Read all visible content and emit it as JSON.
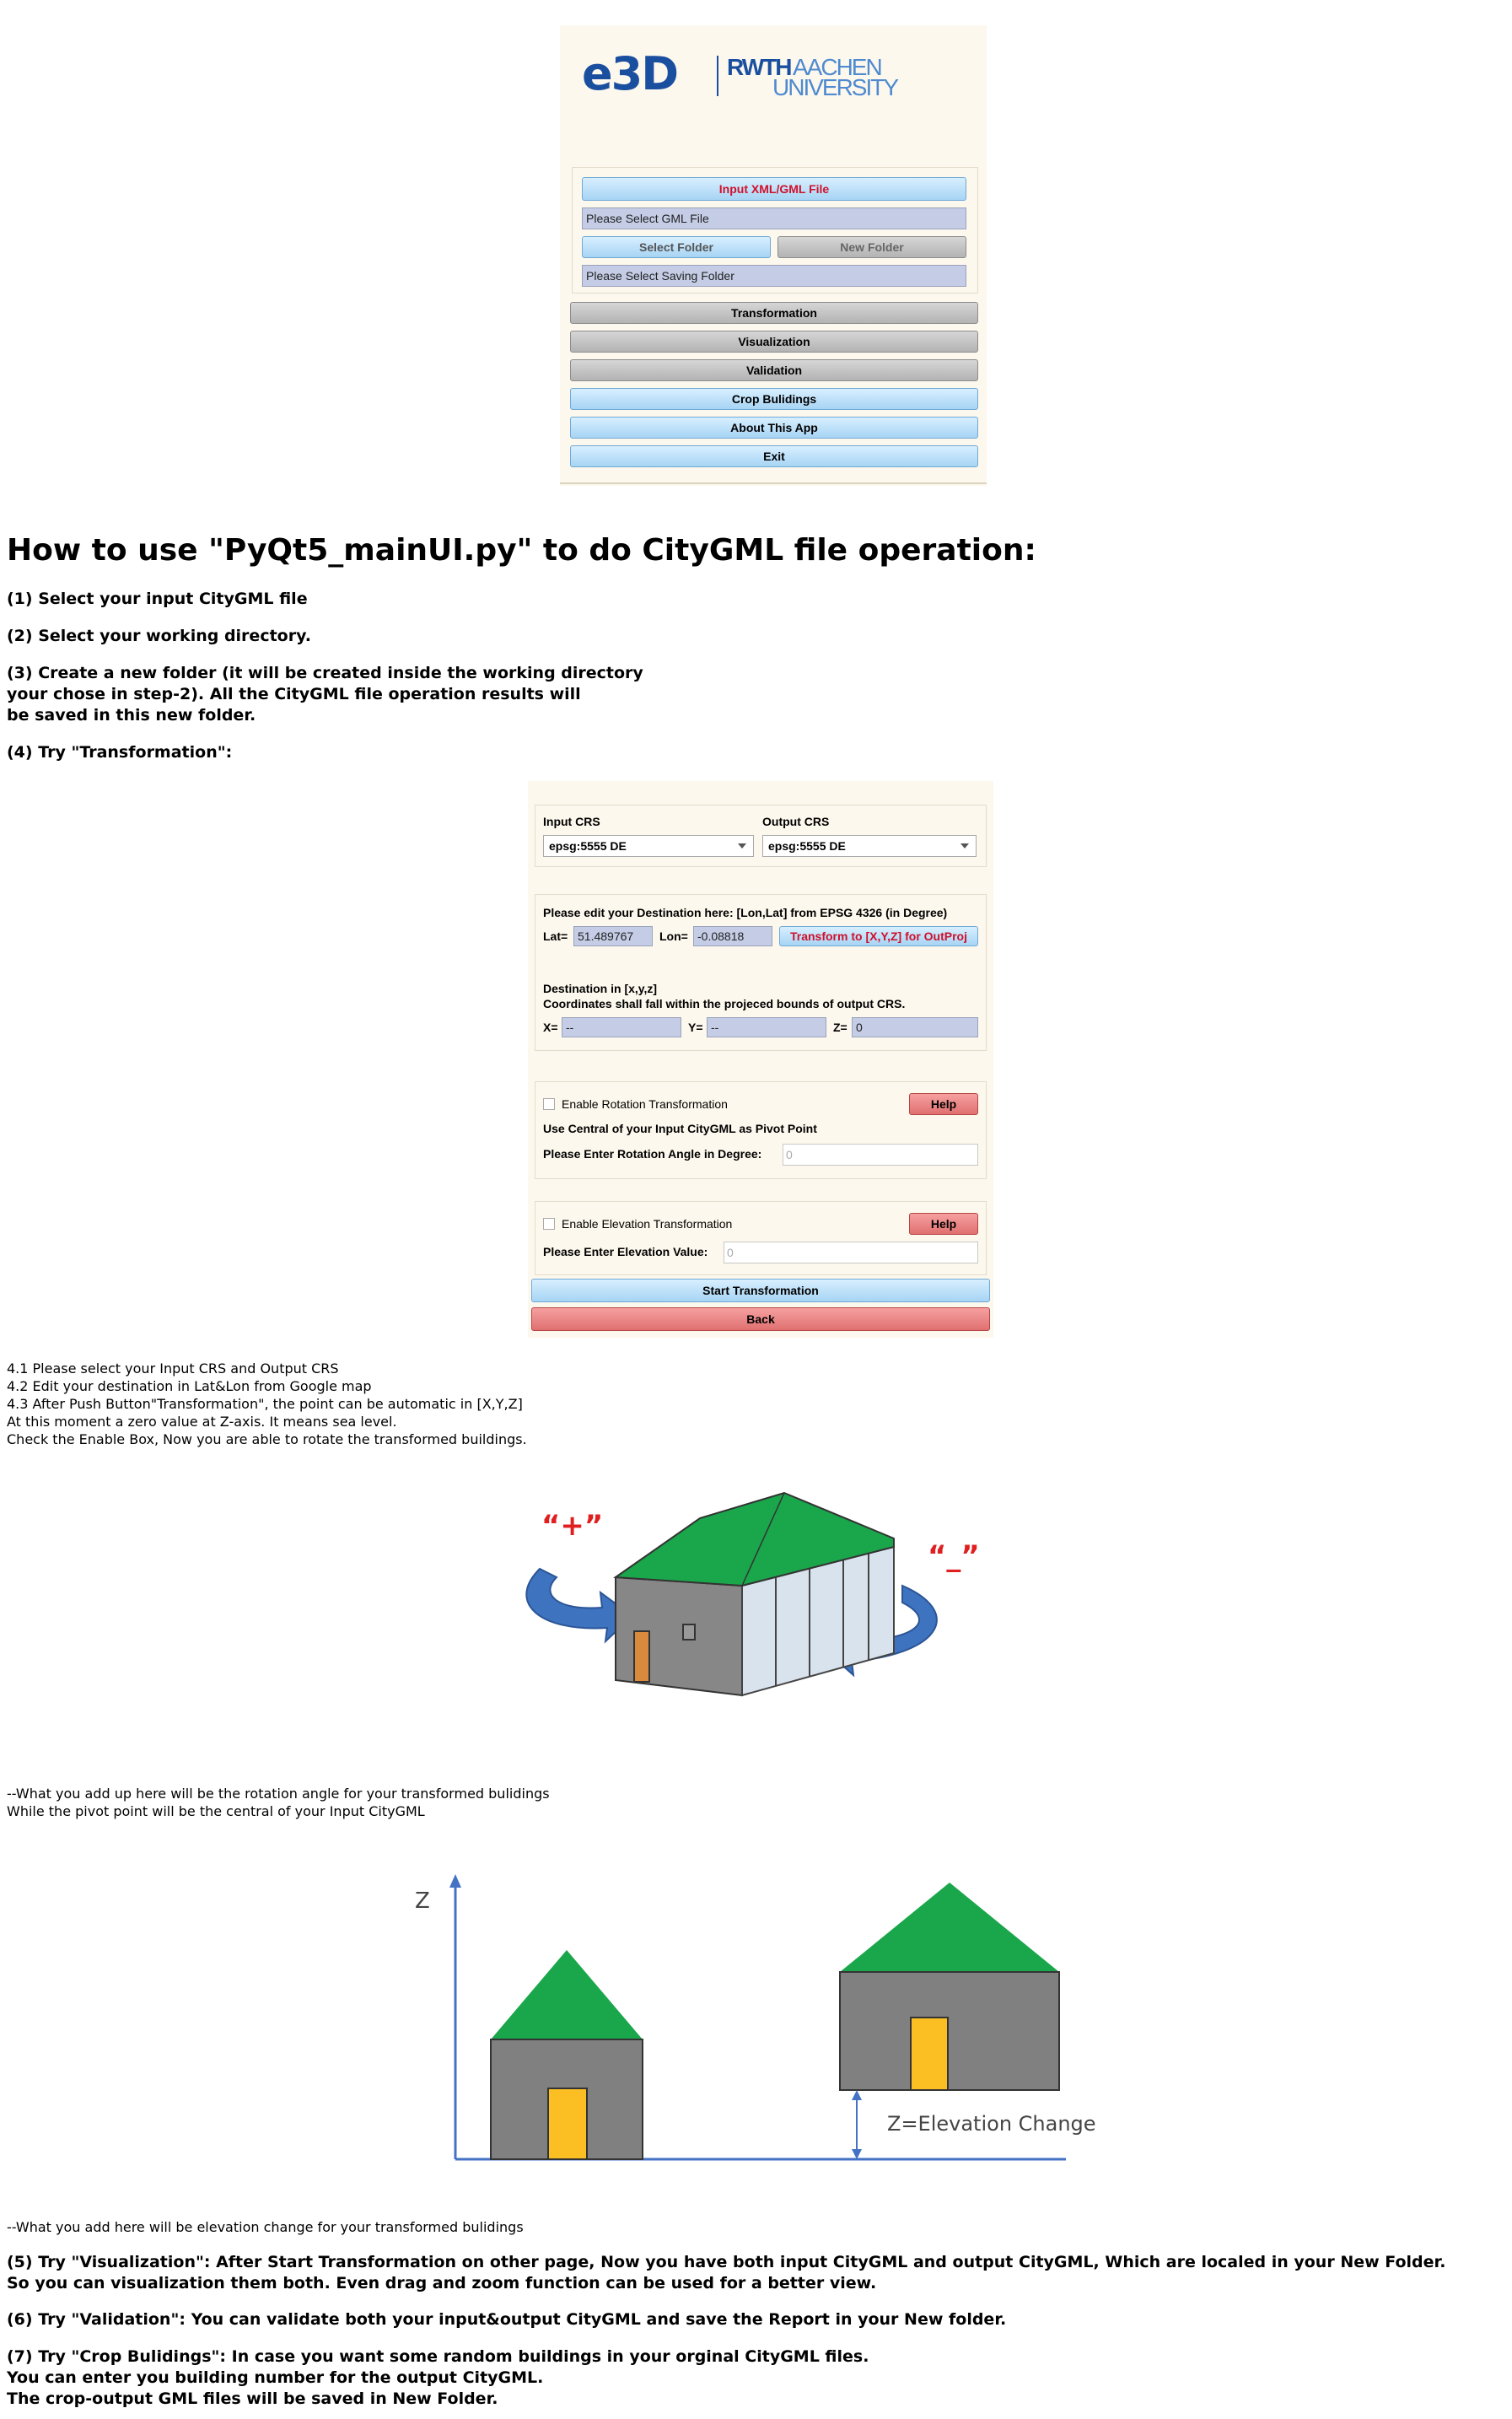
{
  "main_window": {
    "logo_e3d": "e3D",
    "logo_rwth": "RWTH",
    "logo_aachen": "AACHEN",
    "logo_university": "UNIVERSITY",
    "input_button": "Input XML/GML File",
    "gml_field": "Please Select GML File",
    "select_folder_button": "Select Folder",
    "new_folder_button": "New Folder",
    "saving_folder_field": "Please Select Saving Folder",
    "transformation_button": "Transformation",
    "visualization_button": "Visualization",
    "validation_button": "Validation",
    "crop_button": "Crop Bulidings",
    "about_button": "About This App",
    "exit_button": "Exit"
  },
  "doc": {
    "title": "How to use \"PyQt5_mainUI.py\" to do CityGML file operation:",
    "step1": "(1) Select your input CityGML file",
    "step2": "(2) Select your working directory.",
    "step3_line1": "(3) Create a new folder (it will be created inside the working directory",
    "step3_line2": "your chose in step-2). All the CityGML file operation results will",
    "step3_line3": "be saved in this new folder.",
    "step4": "(4) Try \"Transformation\":",
    "notes4": [
      "4.1 Please select your Input CRS and Output CRS",
      "4.2 Edit your destination in Lat&Lon from Google map",
      "4.3 After Push Button\"Transformation\", the point can be automatic in [X,Y,Z]",
      "At this moment a zero value at Z-axis. It means sea level.",
      "Check the Enable Box, Now you are able to rotate the transformed buildings."
    ],
    "rotation_note_line1": "--What you add up here will be the rotation angle for your transformed bulidings",
    "rotation_note_line2": "While the pivot point will be the central of your Input CityGML",
    "elevation_note": "--What you add here will be elevation change for your transformed bulidings",
    "step5_line1": "(5) Try \"Visualization\": After Start Transformation on other page, Now you have both input CityGML and output CityGML, Which are localed in your New Folder.",
    "step5_line2": "So you can visualization them both. Even drag and zoom function can be used for a better view.",
    "step6": "(6) Try \"Validation\": You can validate both your input&output CityGML and save the Report in your New folder.",
    "step7_line1": "(7) Try \"Crop Bulidings\": In case you want some random buildings in your orginal CityGML files.",
    "step7_line2": "You can enter you building number for the output CityGML.",
    "step7_line3": "The crop-output GML files will be saved in New Folder."
  },
  "transform_window": {
    "input_crs_label": "Input CRS",
    "output_crs_label": "Output CRS",
    "input_crs_value": "epsg:5555 DE",
    "output_crs_value": "epsg:5555 DE",
    "dest_instruction": "Please edit your Destination here: [Lon,Lat] from EPSG 4326 (in Degree)",
    "lat_label": "Lat=",
    "lat_value": "51.489767",
    "lon_label": "Lon=",
    "lon_value": "-0.08818",
    "transform_xyz_button": "Transform to [X,Y,Z] for OutProj",
    "dest_xyz_label": "Destination in [x,y,z]",
    "coord_note": "Coordinates shall fall within the projeced bounds of output CRS.",
    "x_label": "X=",
    "x_value": "--",
    "y_label": "Y=",
    "y_value": "--",
    "z_label": "Z=",
    "z_value": "0",
    "enable_rotation": "Enable Rotation Transformation",
    "help1": "Help",
    "pivot_label": "Use Central of your Input CityGML as Pivot Point",
    "angle_label": "Please Enter Rotation Angle in Degree:",
    "angle_placeholder": "0",
    "enable_elevation": "Enable Elevation Transformation",
    "help2": "Help",
    "elevation_label": "Please Enter Elevation Value:",
    "elevation_placeholder": "0",
    "start_button": "Start Transformation",
    "back_button": "Back"
  },
  "rotation_figure": {
    "plus_label": "“+”",
    "minus_label": "“_”"
  },
  "elevation_figure": {
    "z_axis_label": "Z",
    "elevation_label": "Z=Elevation Change"
  },
  "colors": {
    "button_blue": "#a7d4f4",
    "button_gray": "#b3b3b3",
    "button_red": "#e07070",
    "roof_green": "#1aa64a",
    "wall_gray": "#808080",
    "door_orange": "#fbbf24",
    "arrow_blue": "#3e73c0",
    "axis_blue": "#4472c4",
    "accent_red": "#e02020"
  }
}
